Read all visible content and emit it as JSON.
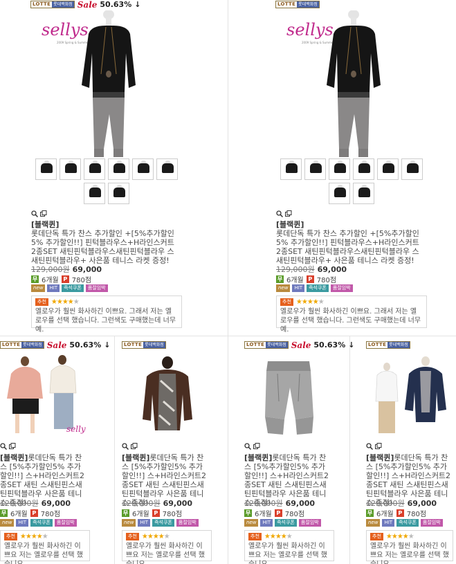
{
  "lotte": {
    "top": "LOTTE",
    "bottom": "롯데백화점"
  },
  "sale": {
    "label": "Sale",
    "percent": "50.63%",
    "arrow": "↓"
  },
  "tools": {
    "zoom_icon": "magnifier-icon",
    "window_icon": "new-window-icon"
  },
  "logo_text": "sellys",
  "logo_sub": "2009 Spring & Summer Collection",
  "badges": {
    "free_mark": "무",
    "months": "6개월",
    "point_mark": "P",
    "points": "780점"
  },
  "tags": {
    "new": "new",
    "hit": "HIT",
    "coupon": "즉석쿠폰",
    "gift": "품절임박"
  },
  "review": {
    "label": "추천",
    "rating": 4,
    "max": 5
  },
  "colors": {
    "sale_red": "#c8102e",
    "rec_orange": "#e5601d",
    "star": "#f0a800",
    "lotte_blue": "#4a62a2"
  },
  "products": [
    {
      "brand": "[블랙퀸]",
      "title": "롯데단독 특가 찬스 추가할인 +[5%추가할인 5% 추가할인!!] 핀턱블라우스+H라인스커트2종SET 새틴핀턱블라우스새틴핀턱블라우 스새틴핀턱블라우+ 사은품 테니스 라켓 증정!",
      "orig_price": "129,000원",
      "price": "69,000",
      "review_text": "옐로우가 훨씬 화사하긴 이쁘요. 그래서 저는 옐로우를 선택 했습니다. 그런색도 구매했는데 너무 예."
    },
    {
      "brand": "[블랙퀸]",
      "title": "롯데단독 특가 찬스 추가할인 +[5%추가할인 5% 추가할인!!] 핀턱블라우스+H라인스커트2종SET 새틴핀턱블라우스새틴핀턱블라우 스새틴핀턱블라우+ 사은품 테니스 라켓 증정!",
      "orig_price": "129,000원",
      "price": "69,000",
      "review_text": "옐로우가 훨씬 화사하긴 이쁘요. 그래서 저는 옐로우를 선택 했습니다. 그런색도 구매했는데 너무 예."
    },
    {
      "brand": "[블랙퀸]",
      "title": "롯데단독 특가 찬스 [5%추가할인5% 추가할인!!] 스+H라인스커트2종SET 새틴 스새틴핀스새틴핀턱블라우 사은품 테니스 증정!",
      "orig_price": "129,000원",
      "price": "69,000",
      "review_text": "옐로우가 훨씬 화사하긴 이쁘요 저는 옐로우를 선택 했습니요"
    },
    {
      "brand": "[블랙퀸]",
      "title": "롯데단독 특가 찬스 [5%추가할인5% 추가할인!!] 스+H라인스커트2종SET 새틴 스새틴핀스새틴핀턱블라우 사은품 테니스 증정!",
      "orig_price": "129,000원",
      "price": "69,000",
      "review_text": "옐로우가 훨씬 화사하긴 이쁘요 저는 옐로우를 선택 했습니요"
    },
    {
      "brand": "[블랙퀸]",
      "title": "롯데단독 특가 찬스 [5%추가할인5% 추가할인!!] 스+H라인스커트2종SET 새틴 스새틴핀스새틴핀턱블라우 사은품 테니스 증정!",
      "orig_price": "129,000원",
      "price": "69,000",
      "review_text": "옐로우가 훨씬 화사하긴 이쁘요 저는 옐로우를 선택 했습니요"
    },
    {
      "brand": "[블랙퀸]",
      "title": "롯데단독 특가 찬스 [5%추가할인5% 추가할인!!] 스+H라인스커트2종SET 새틴 스새틴핀스새틴핀턱블라우 사은품 테니스 증정!",
      "orig_price": "129,000원",
      "price": "69,000",
      "review_text": "옐로우가 훨씬 화사하긴 이쁘요 저는 옐로우를 선택 했습니요"
    }
  ]
}
